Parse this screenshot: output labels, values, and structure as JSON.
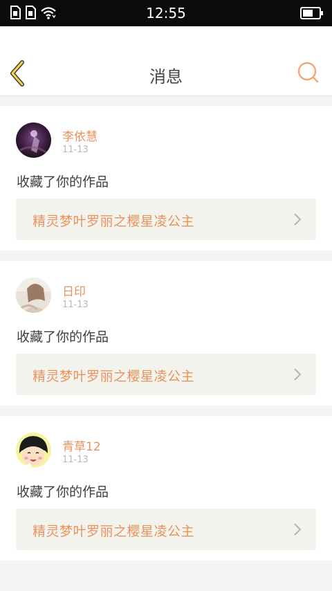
{
  "status_bar": {
    "time": "12:55",
    "icons": [
      "sim-card-1-icon",
      "sim-card-2-icon",
      "wifi-icon",
      "battery-icon"
    ]
  },
  "header": {
    "title": "消息",
    "back_icon": "chevron-left-icon",
    "search_icon": "search-icon"
  },
  "colors": {
    "accent": "#e8925e",
    "back_icon_yellow": "#f3d44a",
    "page_bg": "#f4f4f4",
    "link_bg": "#f3f3ed"
  },
  "notifications": [
    {
      "username": "李依慧",
      "date": "11-13",
      "action": "收藏了你的作品",
      "work_title": "精灵梦叶罗丽之樱星凌公主"
    },
    {
      "username": "日印",
      "date": "11-13",
      "action": "收藏了你的作品",
      "work_title": "精灵梦叶罗丽之樱星凌公主"
    },
    {
      "username": "青草12",
      "date": "11-13",
      "action": "收藏了你的作品",
      "work_title": "精灵梦叶罗丽之樱星凌公主"
    }
  ]
}
